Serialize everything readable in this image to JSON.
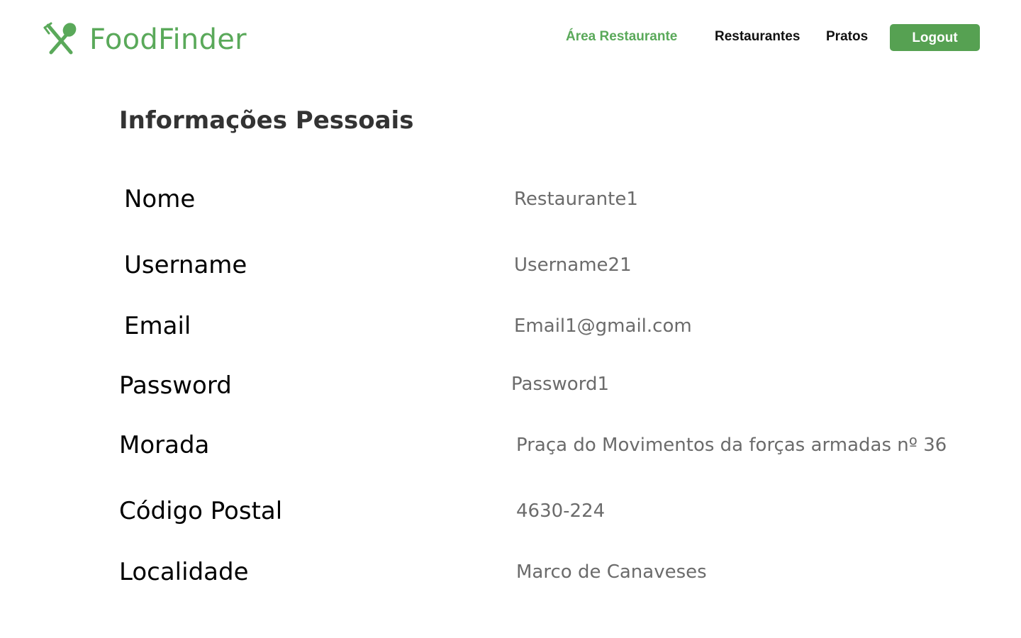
{
  "brand": {
    "name": "FoodFinder",
    "logo_icon": "fork-and-spoon-icon",
    "color": "#5aa95a"
  },
  "nav": {
    "area_restaurante": "Área Restaurante",
    "restaurantes": "Restaurantes",
    "pratos": "Pratos",
    "logout": "Logout",
    "active_color": "#5aa95a",
    "button_color": "#56a152"
  },
  "page": {
    "title": "Informações Pessoais"
  },
  "fields": {
    "nome": {
      "label": "Nome",
      "value": "Restaurante1"
    },
    "username": {
      "label": "Username",
      "value": "Username21"
    },
    "email": {
      "label": "Email",
      "value": "Email1@gmail.com"
    },
    "password": {
      "label": "Password",
      "value": "Password1"
    },
    "morada": {
      "label": "Morada",
      "value": "Praça do Movimentos da forças armadas nº 36"
    },
    "codigo_postal": {
      "label": "Código Postal",
      "value": "4630-224"
    },
    "localidade": {
      "label": "Localidade",
      "value": "Marco de Canaveses"
    }
  }
}
